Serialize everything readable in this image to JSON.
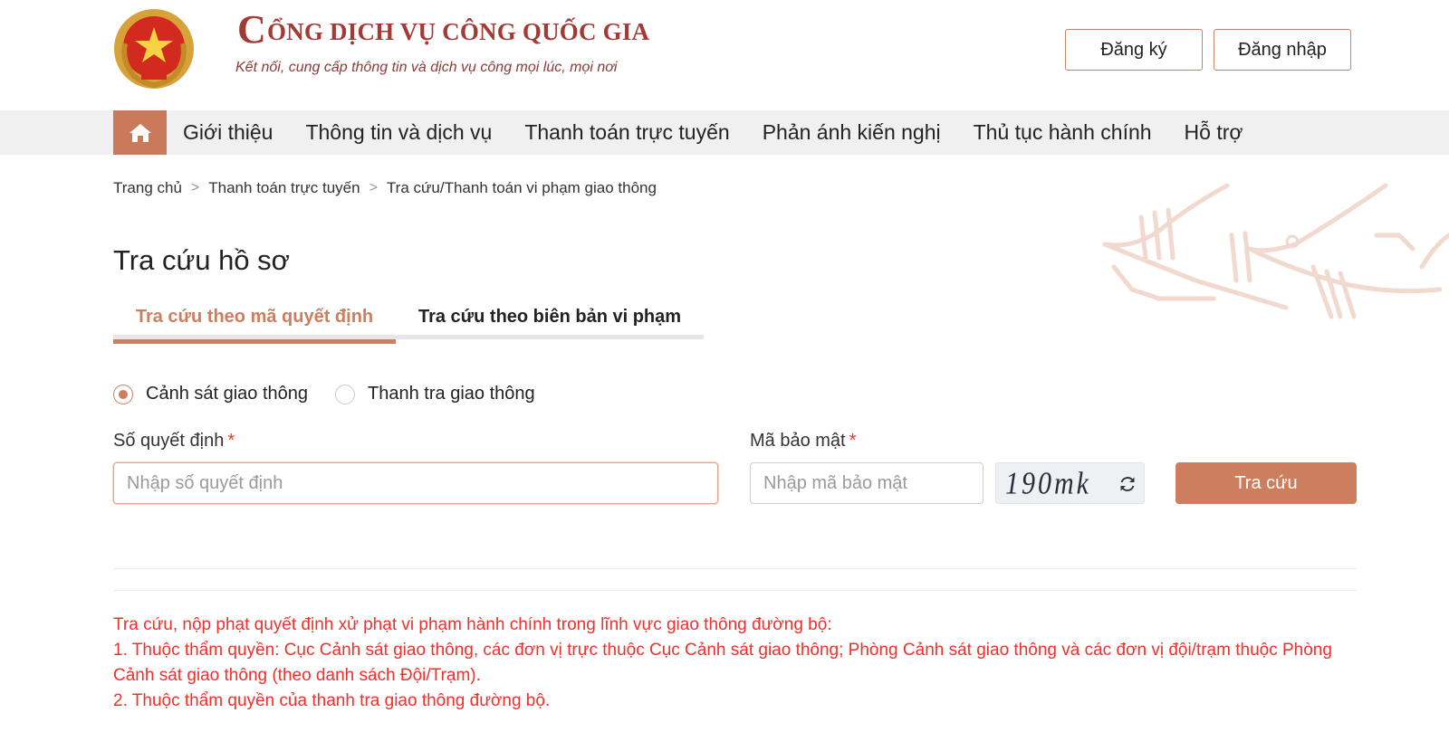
{
  "header": {
    "title_initial": "C",
    "title_rest": "ỔNG DỊCH VỤ CÔNG QUỐC GIA",
    "subtitle": "Kết nối, cung cấp thông tin và dịch vụ công mọi lúc, mọi nơi",
    "register_label": "Đăng ký",
    "login_label": "Đăng nhập"
  },
  "nav": {
    "home_icon": "home-icon",
    "items": [
      {
        "label": "Giới thiệu"
      },
      {
        "label": "Thông tin và dịch vụ"
      },
      {
        "label": "Thanh toán trực tuyến"
      },
      {
        "label": "Phản ánh kiến nghị"
      },
      {
        "label": "Thủ tục hành chính"
      },
      {
        "label": "Hỗ trợ"
      }
    ]
  },
  "breadcrumb": {
    "items": [
      {
        "label": "Trang chủ"
      },
      {
        "label": "Thanh toán trực tuyến"
      },
      {
        "label": "Tra cứu/Thanh toán vi phạm giao thông"
      }
    ],
    "separator": ">"
  },
  "page": {
    "title": "Tra cứu hồ sơ",
    "tabs": [
      {
        "label": "Tra cứu theo mã quyết định",
        "active": true
      },
      {
        "label": "Tra cứu theo biên bản vi phạm",
        "active": false
      }
    ]
  },
  "form": {
    "agencies": [
      {
        "label": "Cảnh sát giao thông",
        "checked": true
      },
      {
        "label": "Thanh tra giao thông",
        "checked": false
      }
    ],
    "decision_label": "Số quyết định",
    "decision_placeholder": "Nhập số quyết định",
    "decision_value": "",
    "captcha_label": "Mã bảo mật",
    "captcha_placeholder": "Nhập mã bảo mật",
    "captcha_value": "",
    "captcha_code": "190mk",
    "required_mark": "*",
    "search_label": "Tra cứu"
  },
  "notes": {
    "lines": [
      "Tra cứu, nộp phạt quyết định xử phạt vi phạm hành chính trong lĩnh vực giao thông đường bộ:",
      "1. Thuộc thẩm quyền: Cục Cảnh sát giao thông, các đơn vị trực thuộc Cục Cảnh sát giao thông; Phòng Cảnh sát giao thông và các đơn vị đội/trạm thuộc Phòng Cảnh sát giao thông (theo danh sách Đội/Trạm).",
      "2. Thuộc thẩm quyền của thanh tra giao thông đường bộ."
    ]
  },
  "colors": {
    "accent": "#cd7e5e",
    "brand": "#a23a35",
    "notice": "#f0302a",
    "nav_bg": "#f0f0f0"
  }
}
